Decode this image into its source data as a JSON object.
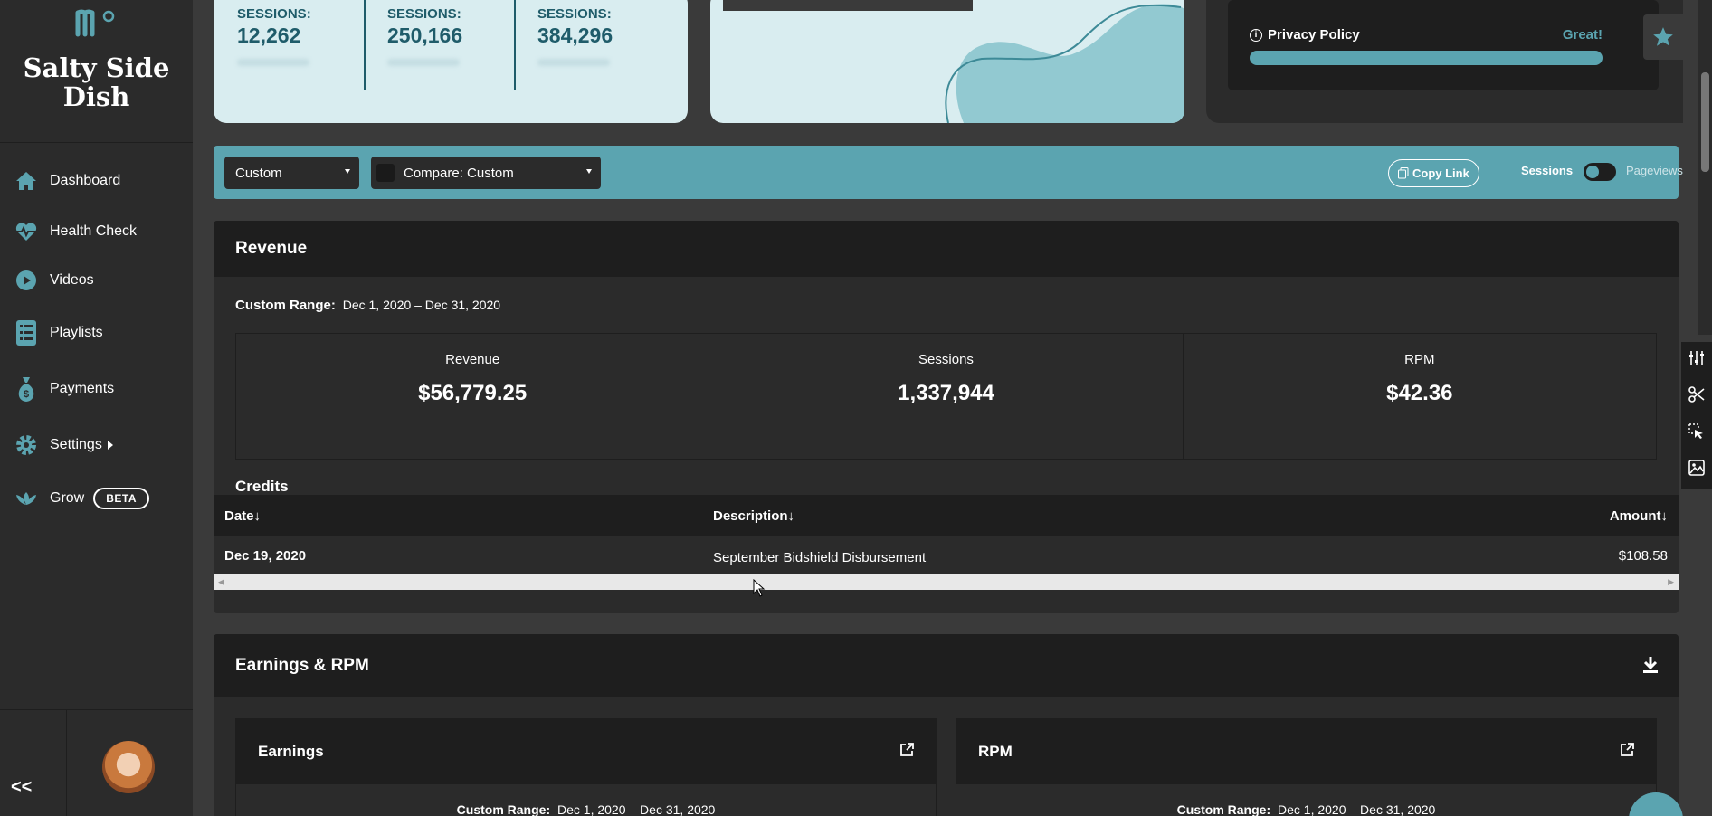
{
  "brand": {
    "name": "Salty Side Dish"
  },
  "sidebar": {
    "items": [
      {
        "label": "Dashboard",
        "icon": "home-icon"
      },
      {
        "label": "Health Check",
        "icon": "heartbeat-icon"
      },
      {
        "label": "Videos",
        "icon": "play-icon"
      },
      {
        "label": "Playlists",
        "icon": "list-icon"
      },
      {
        "label": "Payments",
        "icon": "money-bag-icon"
      },
      {
        "label": "Settings",
        "icon": "gear-icon"
      },
      {
        "label": "Grow",
        "icon": "lotus-icon",
        "badge": "BETA"
      }
    ],
    "collapse_label": "<<"
  },
  "stats": [
    {
      "label": "SESSIONS:",
      "value": "12,262"
    },
    {
      "label": "SESSIONS:",
      "value": "250,166"
    },
    {
      "label": "SESSIONS:",
      "value": "384,296"
    }
  ],
  "privacy": {
    "title": "Privacy Policy",
    "status": "Great!",
    "progress": 1.0
  },
  "filters": {
    "range_select": "Custom",
    "compare_select": "Compare: Custom",
    "copy_link": "Copy Link",
    "toggle_left": "Sessions",
    "toggle_right": "Pageviews"
  },
  "revenue": {
    "title": "Revenue",
    "range_label": "Custom Range:",
    "range_value": "Dec 1, 2020 – Dec 31, 2020",
    "metrics": [
      {
        "label": "Revenue",
        "value": "$56,779.25"
      },
      {
        "label": "Sessions",
        "value": "1,337,944"
      },
      {
        "label": "RPM",
        "value": "$42.36"
      }
    ],
    "credits": {
      "title": "Credits",
      "columns": [
        "Date↓",
        "Description↓",
        "Amount↓"
      ],
      "rows": [
        {
          "date": "Dec 19, 2020",
          "description": "September Bidshield Disbursement",
          "amount": "$108.58"
        }
      ]
    }
  },
  "earnings_rpm": {
    "title": "Earnings & RPM",
    "cards": [
      {
        "title": "Earnings",
        "range_label": "Custom Range:",
        "range_value": "Dec 1, 2020 – Dec 31, 2020"
      },
      {
        "title": "RPM",
        "range_label": "Custom Range:",
        "range_value": "Dec 1, 2020 – Dec 31, 2020"
      }
    ]
  },
  "colors": {
    "accent": "#5ba4b0",
    "dark": "#1e1e1e",
    "panel": "#2b2b2b",
    "light_card": "#d9edf0",
    "stat_text": "#1f5c6a"
  }
}
